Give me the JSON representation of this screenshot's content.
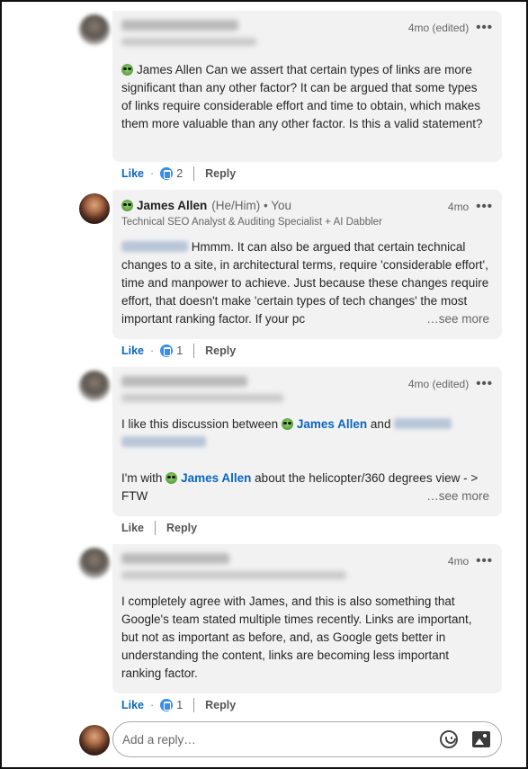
{
  "comments": [
    {
      "time": "4mo (edited)",
      "body": "James Allen Can we assert that certain types of links are more significant than any other factor? It can be argued that some types of links require considerable effort and time to obtain, which makes them more valuable than any other factor. Is this a valid statement?",
      "like_label": "Like",
      "reaction_count": "2",
      "reply_label": "Reply"
    },
    {
      "author": "James Allen",
      "pronouns": "(He/Him) • You",
      "headline": "Technical SEO Analyst & Auditing Specialist + AI Dabbler",
      "time": "4mo",
      "body": "Hmmm. It can also be argued that certain technical changes to a site, in architectural terms, require 'considerable effort', time and manpower to achieve. Just because these changes require effort, that doesn't make 'certain types of tech changes' the most important ranking factor. If your pc",
      "see_more": "…see more",
      "like_label": "Like",
      "reaction_count": "1",
      "reply_label": "Reply"
    },
    {
      "time": "4mo (edited)",
      "body_a": "I like this discussion between",
      "mention_a": "James Allen",
      "body_b": "and",
      "body_c": "I'm with",
      "mention_b": "James Allen",
      "body_d": "about the helicopter/360 degrees view - > FTW",
      "see_more": "…see more",
      "like_label": "Like",
      "reply_label": "Reply"
    },
    {
      "time": "4mo",
      "body": "I completely agree with James, and this is also something that Google's team stated multiple times recently. Links are important, but not as important as before, and, as Google gets better in understanding the content, links are becoming less important ranking factor.",
      "like_label": "Like",
      "reaction_count": "1",
      "reply_label": "Reply"
    }
  ],
  "reply_box": {
    "placeholder": "Add a reply…"
  },
  "icons": {
    "more": "more-options-icon",
    "emoji": "emoji-icon",
    "image": "image-icon",
    "reaction": "like-reaction-icon"
  }
}
